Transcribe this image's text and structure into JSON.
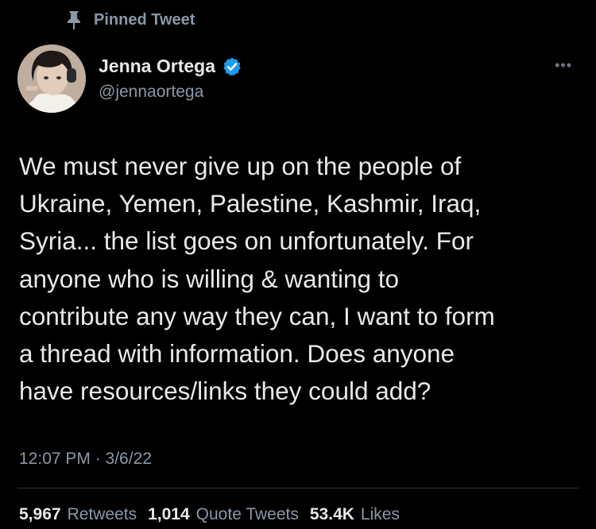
{
  "pinned": {
    "label": "Pinned Tweet",
    "icon": "pin-icon"
  },
  "author": {
    "name": "Jenna Ortega",
    "handle": "@jennaortega",
    "verified": true,
    "verified_color": "#1d9bf0"
  },
  "more_label": "•••",
  "tweet": {
    "text": "We must never give up on the people of\nUkraine, Yemen, Palestine, Kashmir, Iraq,\nSyria... the list goes on unfortunately. For\nanyone who is willing & wanting to\ncontribute any way they can, I want to form\na thread with information. Does anyone\nhave resources/links they could add?",
    "timestamp": "12:07 PM · 3/6/22"
  },
  "stats": [
    {
      "count": "5,967",
      "label": "Retweets"
    },
    {
      "count": "1,014",
      "label": "Quote Tweets"
    },
    {
      "count": "53.4K",
      "label": "Likes"
    }
  ],
  "colors": {
    "background": "#000000",
    "primary_text": "#e7e9ea",
    "secondary_text": "#8b98a5",
    "divider": "#2f3336"
  }
}
